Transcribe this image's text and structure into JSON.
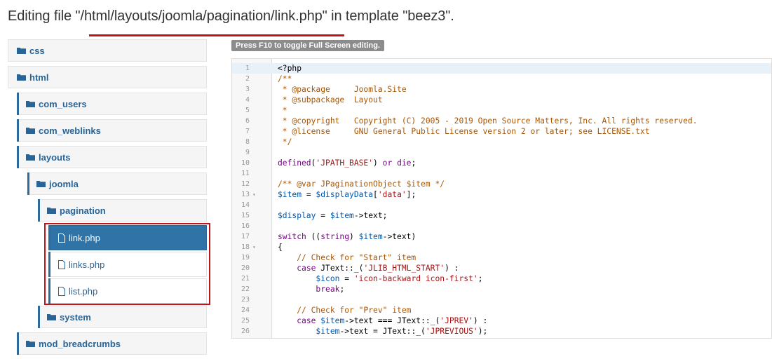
{
  "heading": {
    "prefix": "Editing file \"",
    "path": "/html/layouts/joomla/pagination/link.php",
    "suffix": "\" in template \"beez3\"."
  },
  "tree": {
    "folders": [
      {
        "label": "css",
        "icon": "folder-icon"
      },
      {
        "label": "html",
        "icon": "folder-icon"
      },
      {
        "label": "com_users",
        "icon": "folder-icon"
      },
      {
        "label": "com_weblinks",
        "icon": "folder-icon"
      },
      {
        "label": "layouts",
        "icon": "folder-icon"
      },
      {
        "label": "joomla",
        "icon": "folder-icon"
      },
      {
        "label": "pagination",
        "icon": "folder-open-icon"
      },
      {
        "label": "system",
        "icon": "folder-icon"
      },
      {
        "label": "mod_breadcrumbs",
        "icon": "folder-icon"
      }
    ],
    "files": [
      {
        "label": "link.php",
        "active": true,
        "icon": "file-icon"
      },
      {
        "label": "links.php",
        "active": false,
        "icon": "file-icon"
      },
      {
        "label": "list.php",
        "active": false,
        "icon": "file-icon"
      }
    ]
  },
  "editor": {
    "tip": "Press F10 to toggle Full Screen editing.",
    "current_line": 1,
    "lines": [
      {
        "n": "1",
        "text": "<?php"
      },
      {
        "n": "2",
        "text": "/**"
      },
      {
        "n": "3",
        "text": " * @package     Joomla.Site"
      },
      {
        "n": "4",
        "text": " * @subpackage  Layout"
      },
      {
        "n": "5",
        "text": " *"
      },
      {
        "n": "6",
        "text": " * @copyright   Copyright (C) 2005 - 2019 Open Source Matters, Inc. All rights reserved."
      },
      {
        "n": "7",
        "text": " * @license     GNU General Public License version 2 or later; see LICENSE.txt"
      },
      {
        "n": "8",
        "text": " */"
      },
      {
        "n": "9",
        "text": ""
      },
      {
        "n": "10",
        "text": "defined('JPATH_BASE') or die;"
      },
      {
        "n": "11",
        "text": ""
      },
      {
        "n": "12",
        "text": "/** @var JPaginationObject $item */"
      },
      {
        "n": "13",
        "text": "$item = $displayData['data'];"
      },
      {
        "n": "14",
        "text": ""
      },
      {
        "n": "15",
        "text": "$display = $item->text;"
      },
      {
        "n": "16",
        "text": ""
      },
      {
        "n": "17",
        "text": "switch ((string) $item->text)"
      },
      {
        "n": "18",
        "text": "{"
      },
      {
        "n": "19",
        "text": "    // Check for \"Start\" item"
      },
      {
        "n": "20",
        "text": "    case JText::_('JLIB_HTML_START') :"
      },
      {
        "n": "21",
        "text": "        $icon = 'icon-backward icon-first';"
      },
      {
        "n": "22",
        "text": "        break;"
      },
      {
        "n": "23",
        "text": ""
      },
      {
        "n": "24",
        "text": "    // Check for \"Prev\" item"
      },
      {
        "n": "25",
        "text": "    case $item->text === JText::_('JPREV') :"
      },
      {
        "n": "26",
        "text": "        $item->text = JText::_('JPREVIOUS');"
      }
    ],
    "fold_lines": [
      "13",
      "18"
    ]
  }
}
